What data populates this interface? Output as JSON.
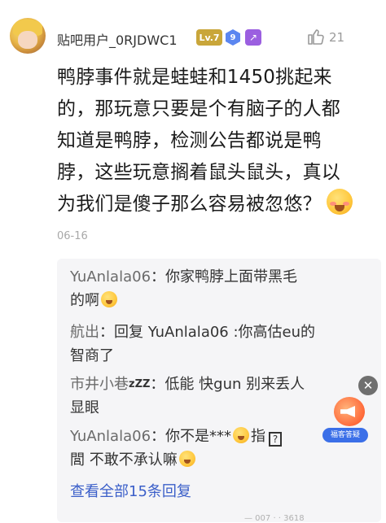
{
  "post": {
    "username": "贴吧用户_0RJDWC1",
    "level_badge": "Lv.7",
    "badge2": "9",
    "badge3": "↗",
    "like_count": "21",
    "body_lines": [
      "鸭脖事件就是蛙蛙和1450挑起来",
      "的，那玩意只要是个有脑子的人都",
      "知道是鸭脖，检测公告都说是鸭",
      "脖，这些玩意搁着鼠头鼠头，真以",
      "为我们是傻子那么容易被忽悠？"
    ],
    "date": "06-16"
  },
  "replies": [
    {
      "name": "YuAnlala06",
      "sep": "：",
      "line1": "你家鸭脖上面带黑毛",
      "line2": "的啊"
    },
    {
      "name": "航出",
      "sep": "：",
      "line1": "回复 YuAnlala06 :你高估eu的",
      "line2": "智商了"
    },
    {
      "name": "市井小巷",
      "zzz": "zZZ",
      "sep": "：",
      "line1": "低能 快gun 别来丢人",
      "line2": "显眼"
    },
    {
      "name": "YuAnlala06",
      "sep": "：",
      "line1a": "你不是***",
      "line1b": "指",
      "tofu": "?",
      "line2a": "閭",
      "line2b": " 不敢不承认嘛"
    }
  ],
  "view_all": "查看全部15条回复",
  "float_widget": {
    "label": "福客答疑"
  },
  "bottom_peek": "— 007 · · 3618"
}
